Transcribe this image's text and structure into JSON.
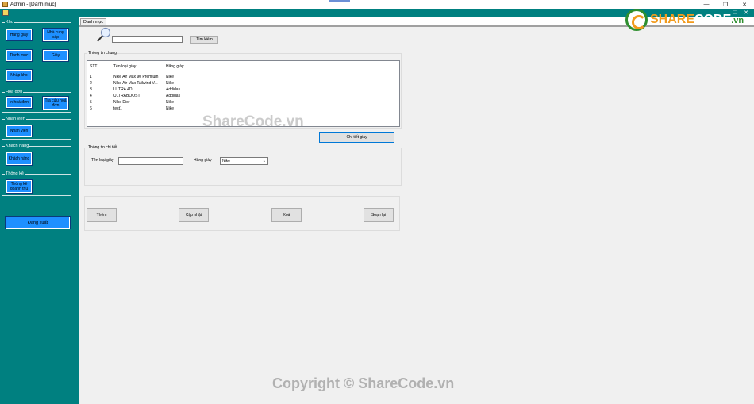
{
  "window": {
    "title": "Admin - [Danh mục]",
    "controls": [
      "—",
      "❐",
      "✕"
    ],
    "mdi_controls": "— ❐ ✕"
  },
  "sidebar": {
    "groups": [
      {
        "legend": "Kho",
        "buttons": [
          "Hãng giày",
          "Nhà cung cấp",
          "Danh mục",
          "Giày",
          "Nhập kho"
        ]
      },
      {
        "legend": "Hoá đơn",
        "buttons": [
          "In hoá đơn",
          "Tra cứu hoá đơn"
        ]
      },
      {
        "legend": "Nhân viên",
        "buttons": [
          "Nhân viên"
        ]
      },
      {
        "legend": "Khách hàng",
        "buttons": [
          "Khách hàng"
        ]
      },
      {
        "legend": "Thống kê",
        "buttons": [
          "Thống kê doanh thu"
        ]
      }
    ],
    "logout_label": "Đăng xuất"
  },
  "main": {
    "tab_label": "Danh mục",
    "search": {
      "value": "",
      "button_label": "Tìm kiếm"
    },
    "general_info": {
      "legend": "Thông tin chung",
      "columns": [
        "STT",
        "Tên loại giày",
        "Hãng giày"
      ],
      "rows": [
        [
          "1",
          "Nike Air Max 90 Premium",
          "Nike"
        ],
        [
          "2",
          "Nike Air Max Tailwind V...",
          "Nike"
        ],
        [
          "3",
          "ULTRA 4D",
          "Addidas"
        ],
        [
          "4",
          "ULTRABOOST",
          "Addidas"
        ],
        [
          "5",
          "Nike Dior",
          "Nike"
        ],
        [
          "6",
          "test1",
          "Nike"
        ]
      ]
    },
    "detail_button_label": "Chi tiết giày",
    "detail_info": {
      "legend": "Thông tin chi tiết",
      "type_label": "Tên loại giày",
      "type_value": "",
      "brand_label": "Hãng giày",
      "brand_value": "Nike"
    },
    "actions": {
      "add": "Thêm",
      "update": "Cập nhật",
      "delete": "Xoá",
      "reset": "Soạn lại"
    }
  },
  "watermarks": {
    "logo_share": "SHARE",
    "logo_code": "CODE",
    "logo_vn": ".vn",
    "center": "ShareCode.vn",
    "bottom": "Copyright © ShareCode.vn"
  },
  "colors": {
    "sidebar": "#008080",
    "button": "#1e90ff",
    "content": "#f0f0f0"
  }
}
